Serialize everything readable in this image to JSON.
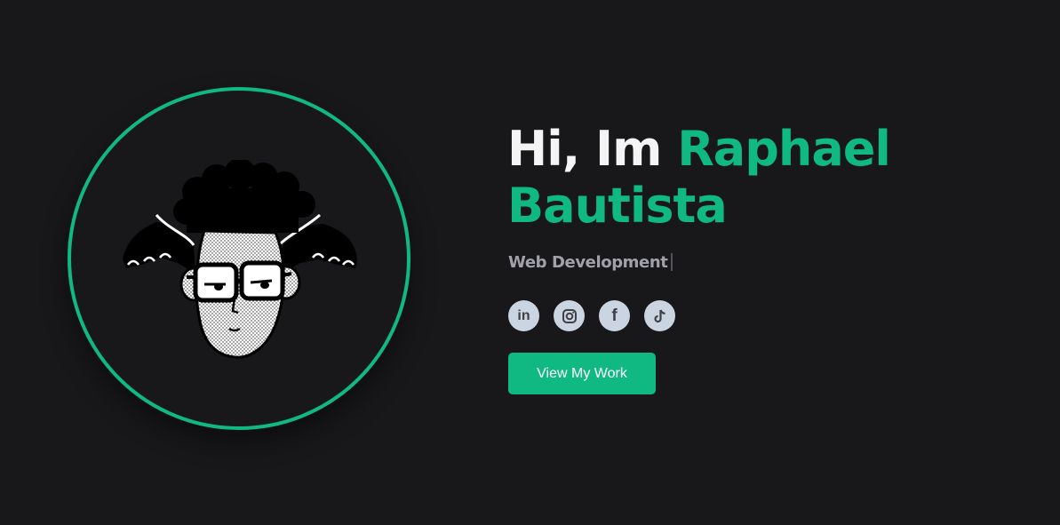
{
  "hero": {
    "greeting": "Hi, Im",
    "first_name": "Raphael",
    "last_name": "Bautista",
    "role": "Web Development",
    "cta_label": "View My Work"
  },
  "socials": [
    {
      "icon": "linkedin-icon",
      "glyph": "in"
    },
    {
      "icon": "instagram-icon"
    },
    {
      "icon": "facebook-icon",
      "glyph": "f"
    },
    {
      "icon": "tiktok-icon"
    }
  ],
  "colors": {
    "background": "#18181b",
    "accent": "#10b981",
    "text": "#f4f4f5",
    "muted": "#a1a1aa",
    "icon_bg": "#cbd5e1"
  }
}
